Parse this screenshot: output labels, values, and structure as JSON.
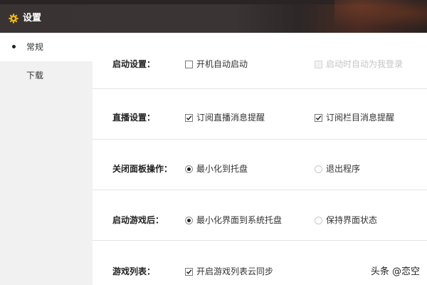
{
  "window": {
    "title": "设置",
    "icon": "gear-icon",
    "accent_color": "#e8b21a"
  },
  "sidebar": {
    "items": [
      {
        "label": "常规",
        "active": true
      },
      {
        "label": "下载",
        "active": false
      }
    ]
  },
  "settings": {
    "startup": {
      "label": "启动设置：",
      "options": [
        {
          "label": "开机自动启动",
          "checked": false,
          "enabled": true
        },
        {
          "label": "启动时自动为我登录",
          "checked": false,
          "enabled": false
        }
      ]
    },
    "live": {
      "label": "直播设置：",
      "options": [
        {
          "label": "订阅直播消息提醒",
          "checked": true,
          "enabled": true
        },
        {
          "label": "订阅栏目消息提醒",
          "checked": true,
          "enabled": true
        }
      ]
    },
    "close_panel": {
      "label": "关闭面板操作：",
      "options": [
        {
          "label": "最小化到托盘",
          "selected": true
        },
        {
          "label": "退出程序",
          "selected": false
        }
      ]
    },
    "after_game_start": {
      "label": "启动游戏后：",
      "options": [
        {
          "label": "最小化界面到系统托盘",
          "selected": true
        },
        {
          "label": "保持界面状态",
          "selected": false
        }
      ]
    },
    "game_list": {
      "label": "游戏列表：",
      "options": [
        {
          "label": "开启游戏列表云同步",
          "checked": true,
          "enabled": true
        }
      ]
    }
  },
  "watermark": "头条 @恋空"
}
